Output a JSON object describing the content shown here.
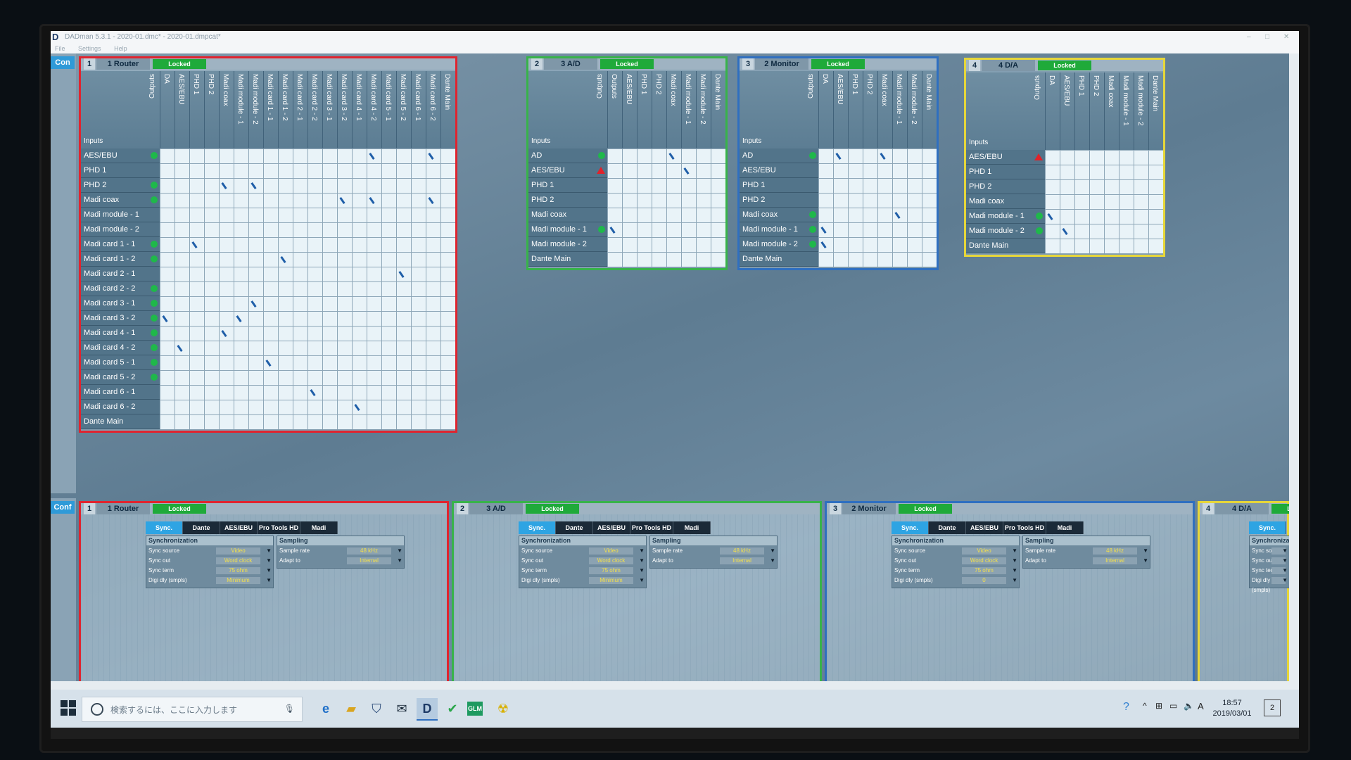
{
  "window": {
    "title": "DADman 5.3.1 - 2020-01.dmc* - 2020-01.dmpcat*",
    "controls": [
      "–",
      "□",
      "✕"
    ]
  },
  "menu": [
    "File",
    "Settings",
    "Help"
  ],
  "side_tabs": {
    "top": "Con",
    "bottom": "Conf"
  },
  "common": {
    "locked": "Locked",
    "inputs": "Inputs",
    "outputs": "Outputs"
  },
  "routing_panels": [
    {
      "num": "1",
      "name": "1 Router",
      "border": "#e0242f",
      "outputs": [
        "DA",
        "AES/EBU",
        "PHD 1",
        "PHD 2",
        "Madi coax",
        "Madi module - 1",
        "Madi module - 2",
        "Madi card 1 - 1",
        "Madi card 1 - 2",
        "Madi card 2 - 1",
        "Madi card 2 - 2",
        "Madi card 3 - 1",
        "Madi card 3 - 2",
        "Madi card 4 - 1",
        "Madi card 4 - 2",
        "Madi card 5 - 1",
        "Madi card 5 - 2",
        "Madi card 6 - 1",
        "Madi card 6 - 2",
        "Dante Main"
      ],
      "inputs": [
        {
          "label": "AES/EBU",
          "status": "green"
        },
        {
          "label": "PHD 1",
          "status": "none"
        },
        {
          "label": "PHD 2",
          "status": "green"
        },
        {
          "label": "Madi coax",
          "status": "green"
        },
        {
          "label": "Madi module - 1",
          "status": "none"
        },
        {
          "label": "Madi module - 2",
          "status": "none"
        },
        {
          "label": "Madi card 1 - 1",
          "status": "green"
        },
        {
          "label": "Madi card 1 - 2",
          "status": "green"
        },
        {
          "label": "Madi card 2 - 1",
          "status": "none"
        },
        {
          "label": "Madi card 2 - 2",
          "status": "green"
        },
        {
          "label": "Madi card 3 - 1",
          "status": "green"
        },
        {
          "label": "Madi card 3 - 2",
          "status": "green"
        },
        {
          "label": "Madi card 4 - 1",
          "status": "green"
        },
        {
          "label": "Madi card 4 - 2",
          "status": "green"
        },
        {
          "label": "Madi card 5 - 1",
          "status": "green"
        },
        {
          "label": "Madi card 5 - 2",
          "status": "green"
        },
        {
          "label": "Madi card 6 - 1",
          "status": "none"
        },
        {
          "label": "Madi card 6 - 2",
          "status": "none"
        },
        {
          "label": "Dante Main",
          "status": "none"
        }
      ]
    },
    {
      "num": "2",
      "name": "3 A/D",
      "border": "#38b34a",
      "outputs": [
        "Outputs",
        "AES/EBU",
        "PHD 1",
        "PHD 2",
        "Madi coax",
        "Madi module - 1",
        "Madi module - 2",
        "Dante Main"
      ],
      "inputs": [
        {
          "label": "AD",
          "status": "green"
        },
        {
          "label": "AES/EBU",
          "status": "warn"
        },
        {
          "label": "PHD 1",
          "status": "none"
        },
        {
          "label": "PHD 2",
          "status": "none"
        },
        {
          "label": "Madi coax",
          "status": "none"
        },
        {
          "label": "Madi module - 1",
          "status": "green"
        },
        {
          "label": "Madi module - 2",
          "status": "none"
        },
        {
          "label": "Dante Main",
          "status": "none"
        }
      ]
    },
    {
      "num": "3",
      "name": "2 Monitor",
      "border": "#2f6fc0",
      "outputs": [
        "DA",
        "AES/EBU",
        "PHD 1",
        "PHD 2",
        "Madi coax",
        "Madi module - 1",
        "Madi module - 2",
        "Dante Main"
      ],
      "inputs": [
        {
          "label": "AD",
          "status": "green"
        },
        {
          "label": "AES/EBU",
          "status": "none"
        },
        {
          "label": "PHD 1",
          "status": "none"
        },
        {
          "label": "PHD 2",
          "status": "none"
        },
        {
          "label": "Madi coax",
          "status": "green"
        },
        {
          "label": "Madi module - 1",
          "status": "green"
        },
        {
          "label": "Madi module - 2",
          "status": "green"
        },
        {
          "label": "Dante Main",
          "status": "none"
        }
      ]
    },
    {
      "num": "4",
      "name": "4 D/A",
      "border": "#e6d63a",
      "outputs": [
        "DA",
        "AES/EBU",
        "PHD 1",
        "PHD 2",
        "Madi coax",
        "Madi module - 1",
        "Madi module - 2",
        "Dante Main"
      ],
      "inputs": [
        {
          "label": "AES/EBU",
          "status": "warn"
        },
        {
          "label": "PHD 1",
          "status": "none"
        },
        {
          "label": "PHD 2",
          "status": "none"
        },
        {
          "label": "Madi coax",
          "status": "none"
        },
        {
          "label": "Madi module - 1",
          "status": "green"
        },
        {
          "label": "Madi module - 2",
          "status": "green"
        },
        {
          "label": "Dante Main",
          "status": "none"
        }
      ]
    }
  ],
  "config_panels": [
    {
      "num": "1",
      "name": "1 Router",
      "border": "#e0242f",
      "tabs": [
        "Sync.",
        "Dante",
        "AES/EBU",
        "Pro Tools HD",
        "Madi"
      ],
      "sync": {
        "title": "Synchronization",
        "rows": [
          [
            "Sync source",
            "Video"
          ],
          [
            "Sync out",
            "Word clock"
          ],
          [
            "Sync term",
            "75 ohm"
          ],
          [
            "Digi dly (smpls)",
            "Minimum"
          ]
        ]
      },
      "sampling": {
        "title": "Sampling",
        "rows": [
          [
            "Sample rate",
            "48 kHz"
          ],
          [
            "Adapt to",
            "Internal"
          ]
        ]
      }
    },
    {
      "num": "2",
      "name": "3 A/D",
      "border": "#38b34a",
      "tabs": [
        "Sync.",
        "Dante",
        "AES/EBU",
        "Pro Tools HD",
        "Madi"
      ],
      "sync": {
        "title": "Synchronization",
        "rows": [
          [
            "Sync source",
            "Video"
          ],
          [
            "Sync out",
            "Word clock"
          ],
          [
            "Sync term",
            "75 ohm"
          ],
          [
            "Digi dly (smpls)",
            "Minimum"
          ]
        ]
      },
      "sampling": {
        "title": "Sampling",
        "rows": [
          [
            "Sample rate",
            "48 kHz"
          ],
          [
            "Adapt to",
            "Internal"
          ]
        ]
      }
    },
    {
      "num": "3",
      "name": "2 Monitor",
      "border": "#2f6fc0",
      "tabs": [
        "Sync.",
        "Dante",
        "AES/EBU",
        "Pro Tools HD",
        "Madi"
      ],
      "sync": {
        "title": "Synchronization",
        "rows": [
          [
            "Sync source",
            "Video"
          ],
          [
            "Sync out",
            "Word clock"
          ],
          [
            "Sync term",
            "75 ohm"
          ],
          [
            "Digi dly (smpls)",
            "0"
          ]
        ]
      },
      "sampling": {
        "title": "Sampling",
        "rows": [
          [
            "Sample rate",
            "48 kHz"
          ],
          [
            "Adapt to",
            "Internal"
          ]
        ]
      }
    },
    {
      "num": "4",
      "name": "4 D/A",
      "border": "#e6d63a",
      "tabs": [
        "Sync."
      ],
      "sync": {
        "title": "Synchronization",
        "rows": [
          [
            "Sync source",
            ""
          ],
          [
            "Sync out",
            ""
          ],
          [
            "Sync term",
            ""
          ],
          [
            "Digi dly (smpls)",
            ""
          ]
        ]
      },
      "sampling": null
    }
  ],
  "taskbar": {
    "search_placeholder": "検索するには、ここに入力します",
    "icons": [
      "edge-icon",
      "file-explorer-icon",
      "store-icon",
      "mail-icon",
      "dadman-icon",
      "check-app-icon",
      "glm-icon",
      "radiation-app-icon"
    ],
    "glm_label": "GLM",
    "time": "18:57",
    "date": "2019/03/01",
    "ime": "A",
    "notifications": "2"
  },
  "colors": {
    "locked": "#1faa3a",
    "active_tab": "#2ea4e3",
    "grid": "#e9f3f8"
  }
}
